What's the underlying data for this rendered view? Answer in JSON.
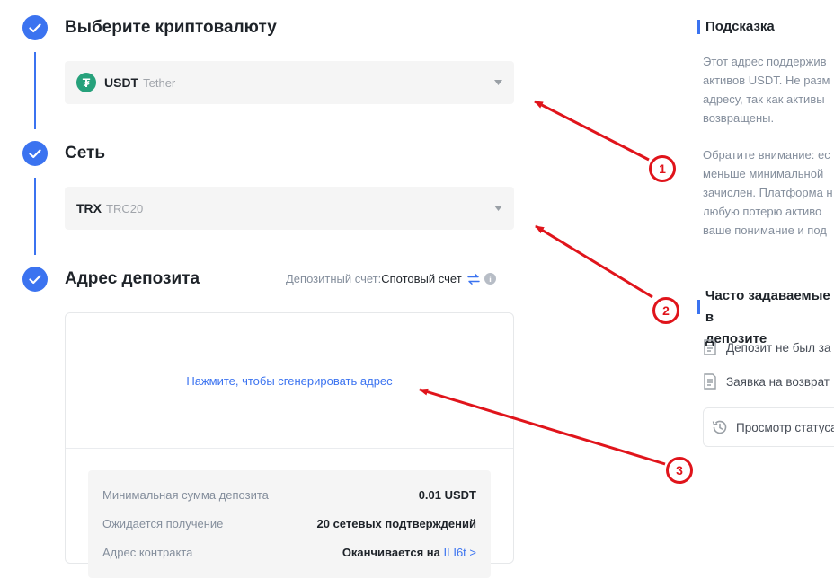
{
  "steps": {
    "crypto": {
      "title": "Выберите криптовалюту",
      "select_main": "USDT",
      "select_sub": "Tether",
      "logo_glyph": "₮"
    },
    "network": {
      "title": "Сеть",
      "select_main": "TRX",
      "select_sub": "TRC20"
    },
    "deposit_address": {
      "title": "Адрес депозита",
      "account_label": "Депозитный счет:",
      "account_value": "Спотовый счет",
      "generate_link": "Нажмите, чтобы сгенерировать адрес",
      "info_rows": [
        {
          "label": "Минимальная сумма депозита",
          "value": "0.01 USDT"
        },
        {
          "label": "Ожидается получение",
          "value": "20 сетевых подтверждений"
        },
        {
          "label": "Адрес контракта",
          "value": "Оканчивается на",
          "link": "ILI6t >"
        }
      ]
    }
  },
  "hint": {
    "title": "Подсказка",
    "paragraph1": [
      "Этот адрес поддержив",
      "активов USDT. Не разм",
      "адресу, так как активы",
      "возвращены."
    ],
    "paragraph2": [
      "Обратите внимание: ес",
      "меньше минимальной",
      "зачислен. Платформа н",
      "любую потерю активо",
      "ваше понимание и под"
    ]
  },
  "faq": {
    "title_line1": "Часто задаваемые в",
    "title_line2": "депозите",
    "items": [
      "Депозит не был за",
      "Заявка на возврат"
    ],
    "status_button": "Просмотр статуса"
  },
  "annotations": [
    "1",
    "2",
    "3"
  ],
  "colors": {
    "accent": "#3b73f0",
    "annotation": "#e0141b",
    "usdt": "#26a17b"
  }
}
